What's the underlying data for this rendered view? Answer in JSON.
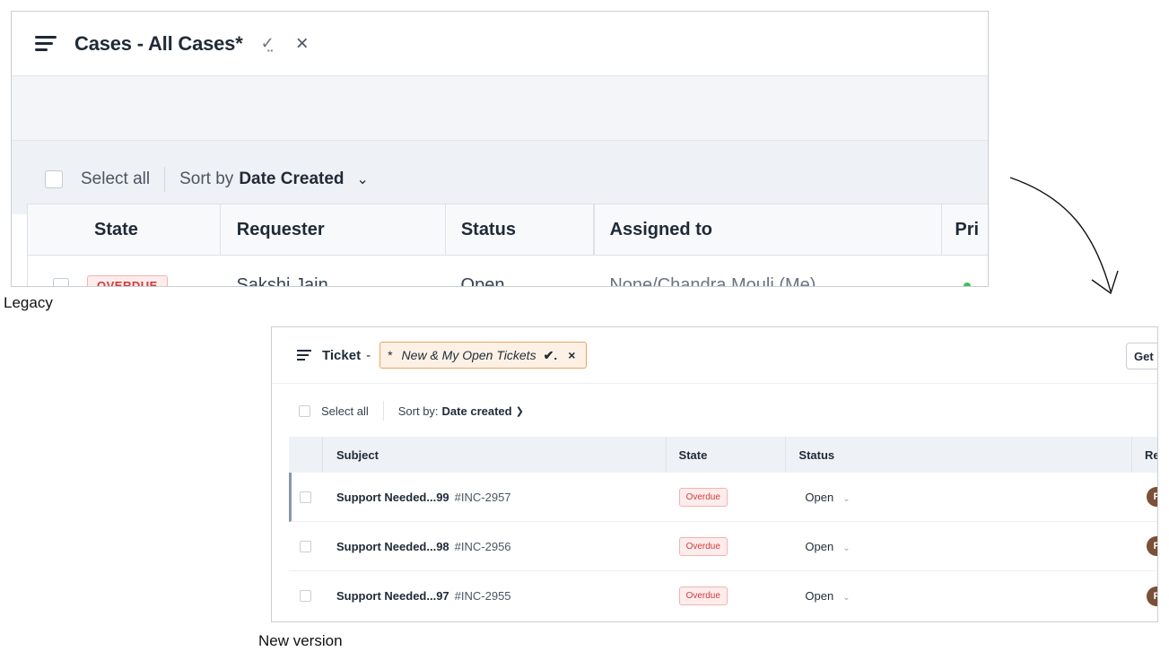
{
  "legacy": {
    "title": "Cases - All Cases*",
    "check_icon": "check-dotted-icon",
    "close_icon": "close-icon",
    "select_all_label": "Select all",
    "sort_prefix": "Sort by",
    "sort_value": "Date Created",
    "columns": [
      "State",
      "Requester",
      "Status",
      "Assigned to",
      "Pri"
    ],
    "row": {
      "state": "OVERDUE",
      "requester": "Sakshi Jain",
      "status": "Open",
      "assigned_to": "None/Chandra Mouli (Me)"
    },
    "caption": "Legacy",
    "overdue_color": "#d33b3b",
    "priority_color": "#3cbf5a"
  },
  "newv": {
    "title": "Ticket",
    "title_sep": "-",
    "view_prefix": "*",
    "view_name": "New & My Open Tickets",
    "view_check": "✔.",
    "view_close": "×",
    "get_button": "Get",
    "select_all_label": "Select all",
    "sort_prefix": "Sort by:",
    "sort_value": "Date created",
    "columns": [
      "Subject",
      "State",
      "Status",
      "Re"
    ],
    "rows": [
      {
        "subject": "Support Needed...99",
        "id": "#INC-2957",
        "state": "Overdue",
        "status": "Open",
        "avatar": "F"
      },
      {
        "subject": "Support Needed...98",
        "id": "#INC-2956",
        "state": "Overdue",
        "status": "Open",
        "avatar": "F"
      },
      {
        "subject": "Support Needed...97",
        "id": "#INC-2955",
        "state": "Overdue",
        "status": "Open",
        "avatar": "F"
      }
    ],
    "caption": "New version",
    "accent_color": "#f0a35a"
  }
}
